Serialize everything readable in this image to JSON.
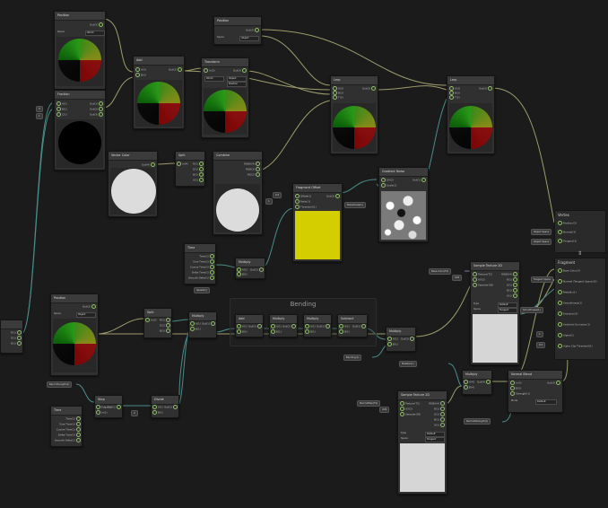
{
  "nodes": {
    "position_top": {
      "title": "Position",
      "out": "Out(3)",
      "space_label": "Space",
      "space_value": "World"
    },
    "position_top2": {
      "title": "Position",
      "out": "Out(3)",
      "space_label": "Space",
      "space_value": "Object"
    },
    "fraction": {
      "title": "Fraction",
      "in": [
        "In(1)",
        "A(1)",
        "B(1)",
        "C(1)"
      ],
      "out": [
        "Out(1)",
        "Out(2)",
        "Out(3)"
      ]
    },
    "add1": {
      "title": "Add",
      "in": [
        "A(3)",
        "B(3)"
      ],
      "out": "Out(3)"
    },
    "transform": {
      "title": "Transform",
      "in": "In(3)",
      "out": "Out(3)",
      "from": "World",
      "to": "Object",
      "type": "Position"
    },
    "lerp_mid": {
      "title": "Lerp",
      "in": [
        "A(3)",
        "B(3)",
        "T(3)"
      ],
      "out": "Out(3)"
    },
    "lerp_top": {
      "title": "Lerp",
      "in": [
        "A(3)",
        "B(3)",
        "T(3)"
      ],
      "out": "Out(3)"
    },
    "vector_color": {
      "title": "Vector Color",
      "out": "Out(4)"
    },
    "split": {
      "title": "Split",
      "in": "In(4)",
      "out": [
        "R(1)",
        "G(1)",
        "B(1)",
        "A(1)"
      ]
    },
    "combine": {
      "title": "Combine",
      "out": [
        "RGBA(4)",
        "RGB(3)",
        "RG(2)"
      ]
    },
    "fragment_offset": {
      "title": "Fragment Offset",
      "in": [
        "Offset(1)",
        "Ratio(1)",
        "Threshold(1)"
      ],
      "out": "Out(3)"
    },
    "gradient_noise": {
      "title": "Gradient Noise",
      "in": [
        "UV(2)",
        "Scale(1)"
      ],
      "out": "Out(1)"
    },
    "time": {
      "title": "Time",
      "out": [
        "Time(1)",
        "Sine Time(1)",
        "Cosine Time(1)",
        "Delta Time(1)",
        "Smooth Delta(1)"
      ]
    },
    "multiply_a": {
      "title": "Multiply",
      "in": [
        "A(1)",
        "B(1)"
      ],
      "out": "Out(1)"
    },
    "position_left": {
      "title": "Position",
      "out": "Out(3)",
      "space_label": "Space",
      "space_value": "Object"
    },
    "split2": {
      "title": "Split",
      "in": "In(3)",
      "out": [
        "R(1)",
        "G(1)",
        "B(1)"
      ]
    },
    "multiply_b": {
      "title": "Multiply",
      "in": [
        "A(1)",
        "B(1)"
      ],
      "out": "Out(1)"
    },
    "add_bend": {
      "title": "Add",
      "in": [
        "A(1)",
        "B(1)"
      ],
      "out": "Out(1)"
    },
    "multiply_bend1": {
      "title": "Multiply",
      "in": [
        "A(1)",
        "B(1)"
      ],
      "out": "Out(1)"
    },
    "multiply_bend2": {
      "title": "Multiply",
      "in": [
        "A(1)",
        "B(1)"
      ],
      "out": "Out(1)"
    },
    "subtract": {
      "title": "Subtract",
      "in": [
        "A(1)",
        "B(1)"
      ],
      "out": "Out(1)"
    },
    "multiply_out": {
      "title": "Multiply",
      "in": [
        "A(1)",
        "B(1)"
      ],
      "out": "Out(3)"
    },
    "step": {
      "title": "Step",
      "in": [
        "Edge(1)",
        "In(1)"
      ],
      "out": "Out(1)"
    },
    "divide": {
      "title": "Divide",
      "in": [
        "A(1)",
        "B(1)"
      ],
      "out": "Out(1)"
    },
    "time2": {
      "title": "Time",
      "out": [
        "Time(1)",
        "Sine Time(1)",
        "Cosine Time(1)",
        "Delta Time(1)",
        "Smooth Delta(1)"
      ]
    },
    "sample_tex_top": {
      "title": "Sample Texture 2D",
      "in": [
        "Texture(T2)",
        "UV(2)",
        "Sampler(SS)"
      ],
      "out": [
        "RGBA(4)",
        "R(1)",
        "G(1)",
        "B(1)",
        "A(1)"
      ],
      "type_label": "Type",
      "type_value": "Default",
      "space_label": "Space",
      "space_value": "Tangent"
    },
    "sample_tex_bot": {
      "title": "Sample Texture 2D",
      "in": [
        "Texture(T2)",
        "UV(2)",
        "Sampler(SS)"
      ],
      "out": [
        "RGBA(4)",
        "R(1)",
        "G(1)",
        "B(1)",
        "A(1)"
      ],
      "type_label": "Type",
      "type_value": "Default",
      "space_label": "Space",
      "space_value": "Tangent"
    },
    "multiply_r": {
      "title": "Multiply",
      "in": [
        "A(4)",
        "B(4)"
      ],
      "out": "Out(4)"
    },
    "normal_blend": {
      "title": "Normal Blend",
      "in": [
        "A(3)",
        "B(3)"
      ],
      "out": "Out(3)",
      "mode_label": "Mode",
      "mode_value": "Default"
    },
    "normal_strength": {
      "title": "Normal Strength",
      "in": [
        "In(3)",
        "Strength(1)"
      ],
      "out": "Out(3)"
    }
  },
  "blocks": {
    "vertex": {
      "title": "Vertex",
      "items": [
        "Position(3)",
        "Normal(3)",
        "Tangent(3)"
      ],
      "inputs": [
        "Object Space",
        "Object Space",
        "Object Space"
      ]
    },
    "fragment": {
      "title": "Fragment",
      "items": [
        "Base Color(3)",
        "Normal (Tangent Space)(3)",
        "Metallic(1)",
        "Smoothness(1)",
        "Emission(3)",
        "Ambient Occlusion(1)",
        "Alpha(1)",
        "Alpha Clip Threshold(1)"
      ],
      "inputs": [
        "Tangent Space",
        "",
        "",
        "",
        "",
        "",
        "1",
        "0.5"
      ]
    }
  },
  "group": {
    "title": "Bending"
  },
  "properties": {
    "base_color": "Base Color(T2)",
    "bending_strength": "Bend Strength(1)",
    "normal_map": "NormalMap(T2)",
    "speed": "Speed(1)",
    "noise_scale": "NoiseScale(1)",
    "smoothness": "Smoothness(1)",
    "metallic": "Metallic(1)",
    "normal_strength_prop": "NormalStrength(1)",
    "bending_prop": "Bending(1)",
    "uv0": "UV0"
  },
  "values": {
    "x_label": "X",
    "x_val": "0",
    "y_val": "1",
    "z_val": "0",
    "offset_val": "0.5",
    "ratio_val": "1",
    "scale_val": "10",
    "uv_val": "UV0",
    "b_val": "2"
  }
}
